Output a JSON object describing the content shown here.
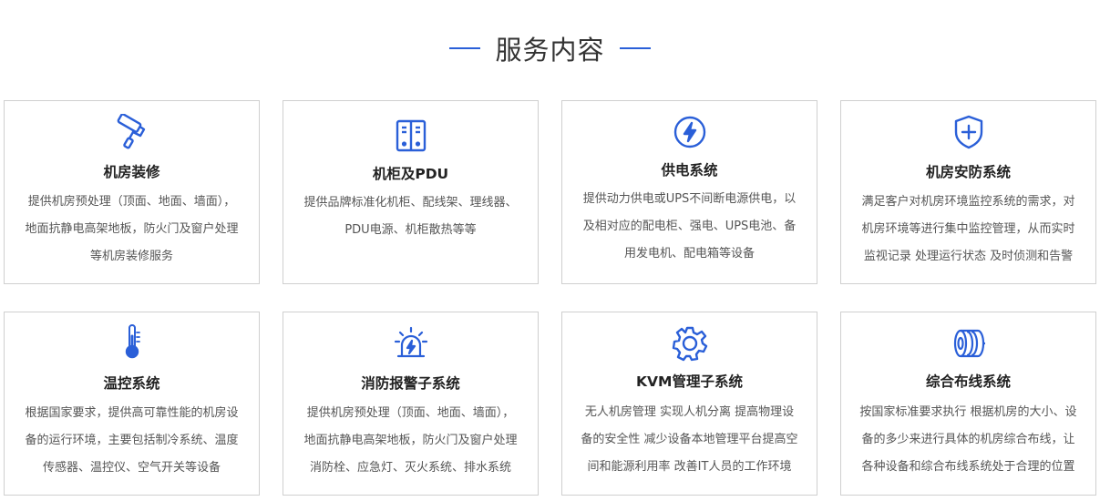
{
  "section": {
    "title": "服务内容"
  },
  "accent_color": "#2a5fd8",
  "services": [
    {
      "icon": "paint-roller-icon",
      "name": "机房装修",
      "lines": [
        "提供机房预处理（顶面、地面、墙面），",
        "地面抗静电高架地板，防火门及窗户处理",
        "等机房装修服务"
      ]
    },
    {
      "icon": "server-cabinet-icon",
      "name": "机柜及PDU",
      "lines": [
        "提供品牌标准化机柜、配线架、理线器、",
        "PDU电源、机柜散热等等"
      ]
    },
    {
      "icon": "lightning-circle-icon",
      "name": "供电系统",
      "lines": [
        "提供动力供电或UPS不间断电源供电，以",
        "及相对应的配电柜、强电、UPS电池、备",
        "用发电机、配电箱等设备"
      ]
    },
    {
      "icon": "shield-plus-icon",
      "name": "机房安防系统",
      "lines": [
        "满足客户对机房环境监控系统的需求，对",
        "机房环境等进行集中监控管理，从而实时",
        "监视记录 处理运行状态 及时侦测和告警"
      ]
    },
    {
      "icon": "thermometer-icon",
      "name": "温控系统",
      "lines": [
        "根据国家要求，提供高可靠性能的机房设",
        "备的运行环境，主要包括制冷系统、温度",
        "传感器、温控仪、空气开关等设备"
      ]
    },
    {
      "icon": "alarm-siren-icon",
      "name": "消防报警子系统",
      "lines": [
        "提供机房预处理（顶面、地面、墙面），",
        "地面抗静电高架地板，防火门及窗户处理",
        "消防栓、应急灯、灭火系统、排水系统"
      ]
    },
    {
      "icon": "gear-icon",
      "name": "KVM管理子系统",
      "lines": [
        "无人机房管理 实现人机分离 提高物理设",
        "备的安全性 减少设备本地管理平台提高空",
        "间和能源利用率 改善IT人员的工作环境"
      ]
    },
    {
      "icon": "cable-coil-icon",
      "name": "综合布线系统",
      "lines": [
        "按国家标准要求执行 根据机房的大小、设",
        "备的多少来进行具体的机房综合布线，让",
        "各种设备和综合布线系统处于合理的位置"
      ]
    }
  ]
}
